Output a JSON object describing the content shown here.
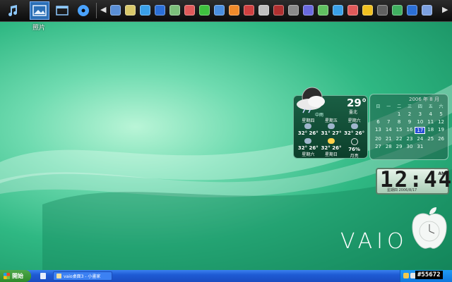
{
  "dock": {
    "active_label": "照片",
    "items": [
      {
        "name": "music-icon"
      },
      {
        "name": "photos-icon"
      },
      {
        "name": "window-icon"
      },
      {
        "name": "dvd-icon"
      }
    ],
    "mini_icons": [
      "#5a8fd6",
      "#d8c86a",
      "#3aa0e8",
      "#2b6fd6",
      "#7cc07a",
      "#e05a5a",
      "#3ec23e",
      "#4a8fe0",
      "#f08a2a",
      "#d04040",
      "#c0c0c0",
      "#b03030",
      "#8a8a8a",
      "#6a6adf",
      "#60c060",
      "#3aa0e8",
      "#e05a5a",
      "#f0c020",
      "#606060",
      "#40b060",
      "#2b6fd6",
      "#7ca0e0"
    ]
  },
  "weather": {
    "temp": "29°",
    "city": "臺北",
    "subtitle": "中雨",
    "days": [
      {
        "label": "星期四",
        "hi": "32°",
        "lo": "26°",
        "icon": "rain"
      },
      {
        "label": "星期五",
        "hi": "31°",
        "lo": "27°",
        "icon": "rain"
      },
      {
        "label": "星期六",
        "hi": "32°",
        "lo": "26°",
        "icon": "rain"
      }
    ],
    "days2": [
      {
        "label": "星期六",
        "hi": "32°",
        "lo": "26°",
        "icon": "rain"
      },
      {
        "label": "星期日",
        "hi": "32°",
        "lo": "26°",
        "icon": "sun"
      },
      {
        "label": "月亮",
        "hi": "76%",
        "lo": "",
        "icon": "moon"
      }
    ]
  },
  "calendar": {
    "title": "2006 年 8 月",
    "headers": [
      "日",
      "一",
      "二",
      "三",
      "四",
      "五",
      "六"
    ],
    "days": [
      "",
      "",
      "1",
      "2",
      "3",
      "4",
      "5",
      "6",
      "7",
      "8",
      "9",
      "10",
      "11",
      "12",
      "13",
      "14",
      "15",
      "16",
      "17",
      "18",
      "19",
      "20",
      "21",
      "22",
      "23",
      "24",
      "25",
      "26",
      "27",
      "28",
      "29",
      "30",
      "31",
      "",
      ""
    ],
    "today": "17"
  },
  "clock": {
    "time": "12:44",
    "ampm": "AM",
    "date": "星期四 2006/8/17"
  },
  "branding": {
    "vaio": "VAIO"
  },
  "taskbar": {
    "start_label": "開始",
    "task_label": "vaio桌面3 - 小畫家"
  },
  "watermark": "#55672"
}
